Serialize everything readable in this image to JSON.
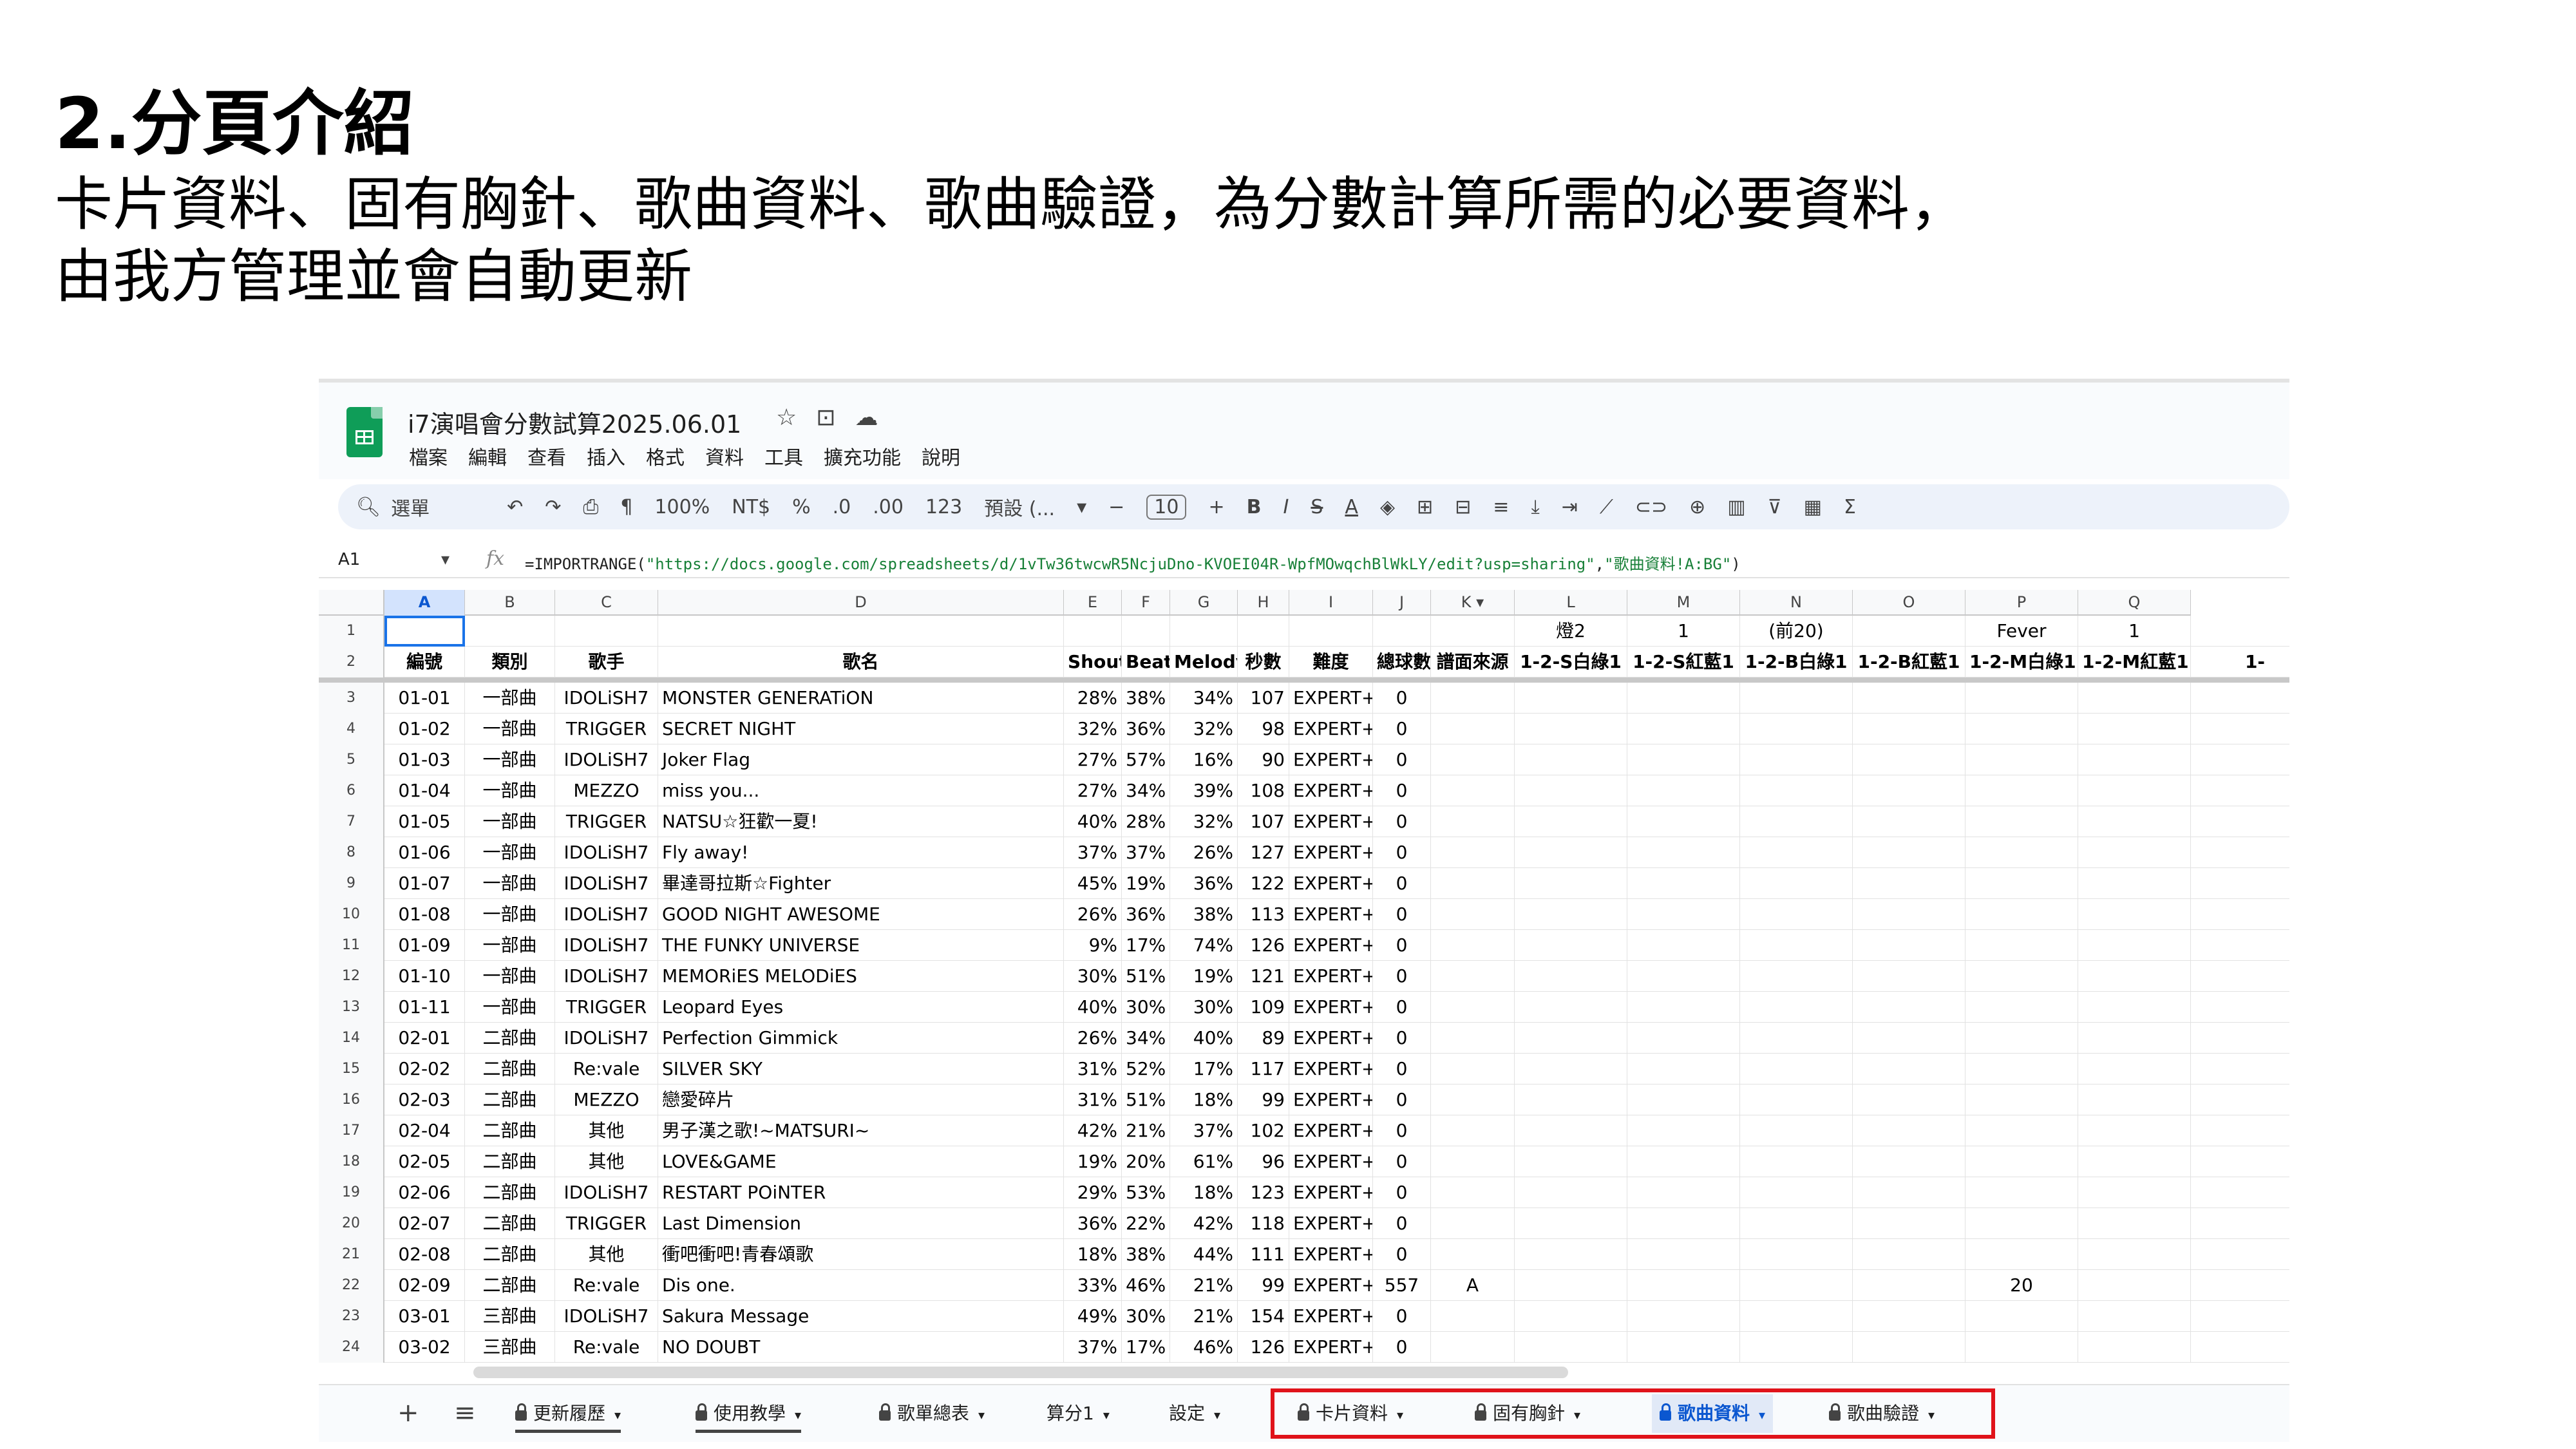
{
  "slide": {
    "title": "2.分頁介紹",
    "desc_line1": "卡片資料、固有胸針、歌曲資料、歌曲驗證，為分數計算所需的必要資料，",
    "desc_line2": "由我方管理並會自動更新"
  },
  "doc": {
    "title": "i7演唱會分數試算2025.06.01",
    "title_icons": [
      "star-icon",
      "move-to-folder-icon",
      "cloud-status-icon"
    ],
    "menu": [
      "檔案",
      "編輯",
      "查看",
      "插入",
      "格式",
      "資料",
      "工具",
      "擴充功能",
      "說明"
    ]
  },
  "toolbar": {
    "search_label": "選單",
    "zoom": "100%",
    "currency": "NT$",
    "percent": "%",
    "decrease_decimal": ".0",
    "increase_decimal": ".00",
    "number_format": "123",
    "font_name": "預設 (...",
    "font_size": "10",
    "bold": "B",
    "italic": "I",
    "strike": "S",
    "text_color": "A",
    "sigma": "Σ"
  },
  "formula_bar": {
    "cell_ref": "A1",
    "fx": "fx",
    "formula_prefix": "=IMPORTRANGE(",
    "formula_url": "\"https://docs.google.com/spreadsheets/d/1vTw36twcwR5NcjuDno-KVOEI04R-WpfMOwqchBlWkLY/edit?usp=sharing\"",
    "formula_comma": ",",
    "formula_range": "\"歌曲資料!A:BG\"",
    "formula_suffix": ")"
  },
  "columns": [
    "A",
    "B",
    "C",
    "D",
    "E",
    "F",
    "G",
    "H",
    "I",
    "J",
    "K",
    "L",
    "M",
    "N",
    "O",
    "P",
    "Q"
  ],
  "row1": {
    "L": "燈2",
    "M": "1",
    "N": "(前20)",
    "P": "Fever",
    "Q": "1"
  },
  "header": [
    "編號",
    "類別",
    "歌手",
    "歌名",
    "Shout",
    "Beat",
    "Melody",
    "秒數",
    "難度",
    "總球數",
    "譜面來源",
    "1-2-S白綠1",
    "1-2-S紅藍1",
    "1-2-B白綠1",
    "1-2-B紅藍1",
    "1-2-M白綠1",
    "1-2-M紅藍1",
    "1-"
  ],
  "rows": [
    {
      "n": "3",
      "id": "01-01",
      "type": "一部曲",
      "artist": "IDOLiSH7",
      "song": "MONSTER GENERATiON",
      "shout": "28%",
      "beat": "38%",
      "melody": "34%",
      "sec": "107",
      "diff": "EXPERT+",
      "total": "0",
      "src": "",
      "p": ""
    },
    {
      "n": "4",
      "id": "01-02",
      "type": "一部曲",
      "artist": "TRIGGER",
      "song": "SECRET NIGHT",
      "shout": "32%",
      "beat": "36%",
      "melody": "32%",
      "sec": "98",
      "diff": "EXPERT+",
      "total": "0",
      "src": "",
      "p": ""
    },
    {
      "n": "5",
      "id": "01-03",
      "type": "一部曲",
      "artist": "IDOLiSH7",
      "song": "Joker Flag",
      "shout": "27%",
      "beat": "57%",
      "melody": "16%",
      "sec": "90",
      "diff": "EXPERT+",
      "total": "0",
      "src": "",
      "p": ""
    },
    {
      "n": "6",
      "id": "01-04",
      "type": "一部曲",
      "artist": "MEZZO",
      "song": "miss you...",
      "shout": "27%",
      "beat": "34%",
      "melody": "39%",
      "sec": "108",
      "diff": "EXPERT+",
      "total": "0",
      "src": "",
      "p": ""
    },
    {
      "n": "7",
      "id": "01-05",
      "type": "一部曲",
      "artist": "TRIGGER",
      "song": "NATSU☆狂歡一夏!",
      "shout": "40%",
      "beat": "28%",
      "melody": "32%",
      "sec": "107",
      "diff": "EXPERT+",
      "total": "0",
      "src": "",
      "p": ""
    },
    {
      "n": "8",
      "id": "01-06",
      "type": "一部曲",
      "artist": "IDOLiSH7",
      "song": "Fly away!",
      "shout": "37%",
      "beat": "37%",
      "melody": "26%",
      "sec": "127",
      "diff": "EXPERT+",
      "total": "0",
      "src": "",
      "p": ""
    },
    {
      "n": "9",
      "id": "01-07",
      "type": "一部曲",
      "artist": "IDOLiSH7",
      "song": "畢達哥拉斯☆Fighter",
      "shout": "45%",
      "beat": "19%",
      "melody": "36%",
      "sec": "122",
      "diff": "EXPERT+",
      "total": "0",
      "src": "",
      "p": ""
    },
    {
      "n": "10",
      "id": "01-08",
      "type": "一部曲",
      "artist": "IDOLiSH7",
      "song": "GOOD NIGHT AWESOME",
      "shout": "26%",
      "beat": "36%",
      "melody": "38%",
      "sec": "113",
      "diff": "EXPERT+",
      "total": "0",
      "src": "",
      "p": ""
    },
    {
      "n": "11",
      "id": "01-09",
      "type": "一部曲",
      "artist": "IDOLiSH7",
      "song": "THE FUNKY UNIVERSE",
      "shout": "9%",
      "beat": "17%",
      "melody": "74%",
      "sec": "126",
      "diff": "EXPERT+",
      "total": "0",
      "src": "",
      "p": ""
    },
    {
      "n": "12",
      "id": "01-10",
      "type": "一部曲",
      "artist": "IDOLiSH7",
      "song": "MEMORiES MELODiES",
      "shout": "30%",
      "beat": "51%",
      "melody": "19%",
      "sec": "121",
      "diff": "EXPERT+",
      "total": "0",
      "src": "",
      "p": ""
    },
    {
      "n": "13",
      "id": "01-11",
      "type": "一部曲",
      "artist": "TRIGGER",
      "song": "Leopard Eyes",
      "shout": "40%",
      "beat": "30%",
      "melody": "30%",
      "sec": "109",
      "diff": "EXPERT+",
      "total": "0",
      "src": "",
      "p": ""
    },
    {
      "n": "14",
      "id": "02-01",
      "type": "二部曲",
      "artist": "IDOLiSH7",
      "song": "Perfection Gimmick",
      "shout": "26%",
      "beat": "34%",
      "melody": "40%",
      "sec": "89",
      "diff": "EXPERT+",
      "total": "0",
      "src": "",
      "p": ""
    },
    {
      "n": "15",
      "id": "02-02",
      "type": "二部曲",
      "artist": "Re:vale",
      "song": "SILVER SKY",
      "shout": "31%",
      "beat": "52%",
      "melody": "17%",
      "sec": "117",
      "diff": "EXPERT+",
      "total": "0",
      "src": "",
      "p": ""
    },
    {
      "n": "16",
      "id": "02-03",
      "type": "二部曲",
      "artist": "MEZZO",
      "song": "戀愛碎片",
      "shout": "31%",
      "beat": "51%",
      "melody": "18%",
      "sec": "99",
      "diff": "EXPERT+",
      "total": "0",
      "src": "",
      "p": ""
    },
    {
      "n": "17",
      "id": "02-04",
      "type": "二部曲",
      "artist": "其他",
      "song": "男子漢之歌!~MATSURI~",
      "shout": "42%",
      "beat": "21%",
      "melody": "37%",
      "sec": "102",
      "diff": "EXPERT+",
      "total": "0",
      "src": "",
      "p": ""
    },
    {
      "n": "18",
      "id": "02-05",
      "type": "二部曲",
      "artist": "其他",
      "song": "LOVE&GAME",
      "shout": "19%",
      "beat": "20%",
      "melody": "61%",
      "sec": "96",
      "diff": "EXPERT+",
      "total": "0",
      "src": "",
      "p": ""
    },
    {
      "n": "19",
      "id": "02-06",
      "type": "二部曲",
      "artist": "IDOLiSH7",
      "song": "RESTART POiNTER",
      "shout": "29%",
      "beat": "53%",
      "melody": "18%",
      "sec": "123",
      "diff": "EXPERT+",
      "total": "0",
      "src": "",
      "p": ""
    },
    {
      "n": "20",
      "id": "02-07",
      "type": "二部曲",
      "artist": "TRIGGER",
      "song": "Last Dimension",
      "shout": "36%",
      "beat": "22%",
      "melody": "42%",
      "sec": "118",
      "diff": "EXPERT+",
      "total": "0",
      "src": "",
      "p": ""
    },
    {
      "n": "21",
      "id": "02-08",
      "type": "二部曲",
      "artist": "其他",
      "song": "衝吧衝吧!青春頌歌",
      "shout": "18%",
      "beat": "38%",
      "melody": "44%",
      "sec": "111",
      "diff": "EXPERT+",
      "total": "0",
      "src": "",
      "p": ""
    },
    {
      "n": "22",
      "id": "02-09",
      "type": "二部曲",
      "artist": "Re:vale",
      "song": "Dis one.",
      "shout": "33%",
      "beat": "46%",
      "melody": "21%",
      "sec": "99",
      "diff": "EXPERT+",
      "total": "557",
      "src": "A",
      "p": "20"
    },
    {
      "n": "23",
      "id": "03-01",
      "type": "三部曲",
      "artist": "IDOLiSH7",
      "song": "Sakura Message",
      "shout": "49%",
      "beat": "30%",
      "melody": "21%",
      "sec": "154",
      "diff": "EXPERT+",
      "total": "0",
      "src": "",
      "p": ""
    },
    {
      "n": "24",
      "id": "03-02",
      "type": "三部曲",
      "artist": "Re:vale",
      "song": "NO DOUBT",
      "shout": "37%",
      "beat": "17%",
      "melody": "46%",
      "sec": "126",
      "diff": "EXPERT+",
      "total": "0",
      "src": "",
      "p": ""
    }
  ],
  "sheet_tabs": [
    {
      "label": "更新履歷",
      "locked": true
    },
    {
      "label": "使用教學",
      "locked": true
    },
    {
      "label": "歌單總表",
      "locked": true
    },
    {
      "label": "算分1",
      "locked": false
    },
    {
      "label": "設定",
      "locked": false
    },
    {
      "label": "卡片資料",
      "locked": true
    },
    {
      "label": "固有胸針",
      "locked": true
    },
    {
      "label": "歌曲資料",
      "locked": true,
      "active": true
    },
    {
      "label": "歌曲驗證",
      "locked": true
    }
  ],
  "colors": {
    "highlight_box": "#e0131a",
    "active_tab": "#0b57d0",
    "sheets_green": "#0f9d58"
  }
}
